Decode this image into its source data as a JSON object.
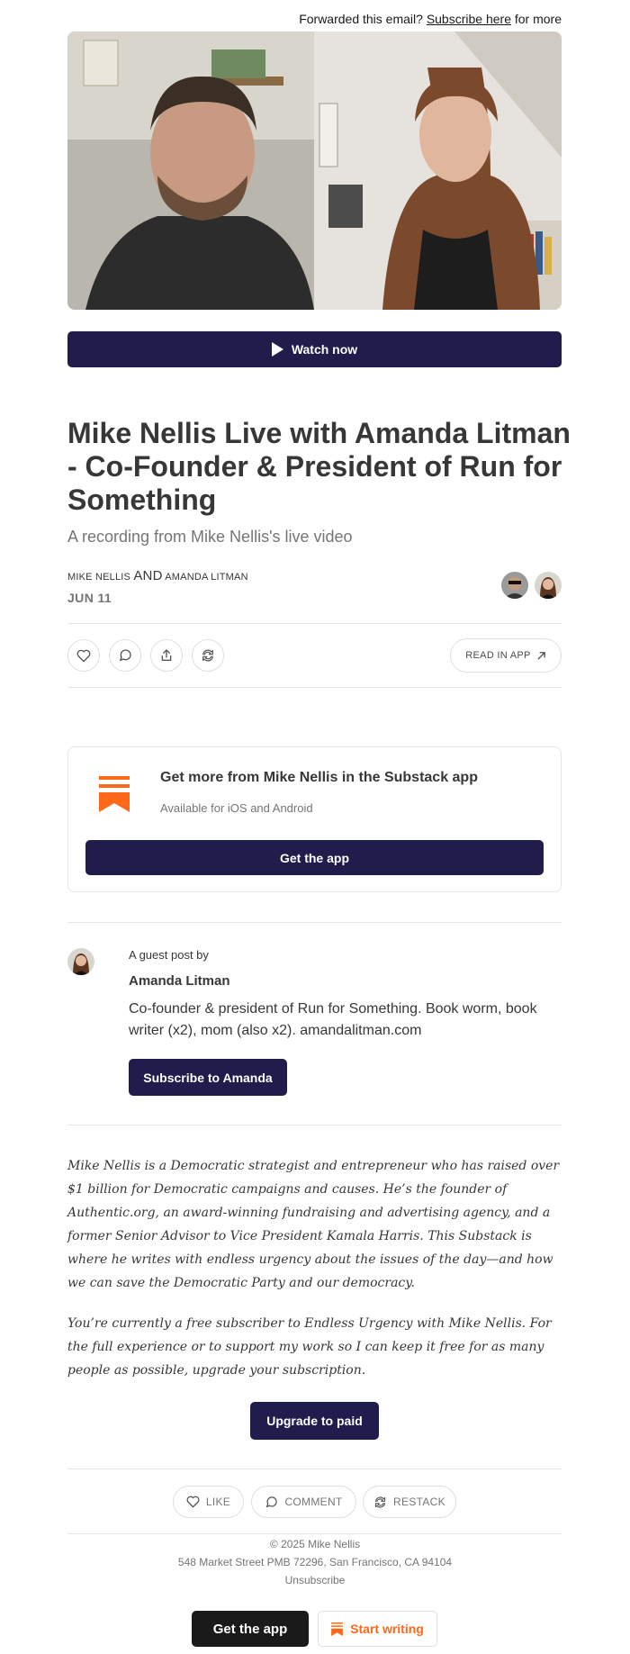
{
  "header": {
    "forward_prefix": "Forwarded this email?",
    "subscribe_link": "Subscribe here",
    "forward_suffix": "for more"
  },
  "video": {
    "watch_label": "Watch now"
  },
  "post": {
    "title": "Mike Nellis Live with Amanda Litman - Co-Founder & President of Run for Something",
    "subtitle": "A recording from Mike Nellis's live video",
    "author1": "Mike Nellis",
    "and": "and",
    "author2": "Amanda Litman",
    "date": "JUN 11"
  },
  "actions": {
    "read_in_app": "READ IN APP"
  },
  "app_card": {
    "title": "Get more from Mike Nellis in the Substack app",
    "subtitle": "Available for iOS and Android",
    "button": "Get the app"
  },
  "guest": {
    "by_label": "A guest post by",
    "name": "Amanda Litman",
    "bio": "Co-founder & president of Run for Something. Book worm, book writer (x2), mom (also x2). amandalitman.com",
    "subscribe_button": "Subscribe to Amanda"
  },
  "footer_text": {
    "para1": "Mike Nellis is a Democratic strategist and entrepreneur who has raised over $1 billion for Democratic campaigns and causes. He’s the founder of Authentic.org, an award-winning fundraising and advertising agency, and a former Senior Advisor to Vice President Kamala Harris. This Substack is where he writes with endless urgency about the issues of the day—and how we can save the Democratic Party and our democracy.",
    "para2": "You’re currently a free subscriber to Endless Urgency with Mike Nellis. For the full experience or to support my work so I can keep it free for as many people as possible, upgrade your subscription.",
    "upgrade_button": "Upgrade to paid"
  },
  "engage": {
    "like": "LIKE",
    "comment": "COMMENT",
    "restack": "RESTACK"
  },
  "footer": {
    "copyright": "© 2025 Mike Nellis",
    "address": "548 Market Street PMB 72296, San Francisco, CA 94104",
    "unsubscribe": "Unsubscribe",
    "get_app": "Get the app",
    "start_writing": "Start writing"
  },
  "colors": {
    "primary_button": "#201c4b",
    "substack_orange": "#ff6719"
  }
}
